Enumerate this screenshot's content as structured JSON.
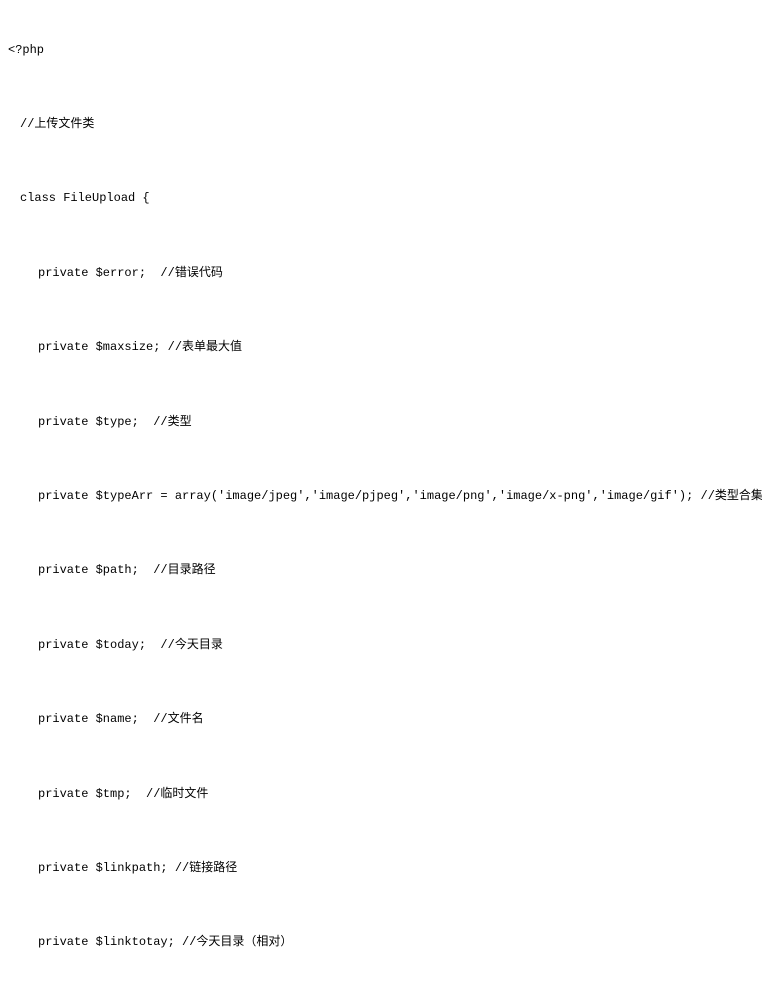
{
  "code": {
    "lines": [
      {
        "indent": 0,
        "text": "<?php"
      },
      {
        "indent": 1,
        "text": "//上传文件类"
      },
      {
        "indent": 1,
        "text": "class FileUpload {"
      },
      {
        "indent": 2,
        "text": "private $error;  //错误代码"
      },
      {
        "indent": 2,
        "text": "private $maxsize; //表单最大值"
      },
      {
        "indent": 2,
        "text": "private $type;  //类型"
      },
      {
        "indent": 2,
        "text": "private $typeArr = array('image/jpeg','image/pjpeg','image/png','image/x-png','image/gif'); //类型合集"
      },
      {
        "indent": 2,
        "text": "private $path;  //目录路径"
      },
      {
        "indent": 2,
        "text": "private $today;  //今天目录"
      },
      {
        "indent": 2,
        "text": "private $name;  //文件名"
      },
      {
        "indent": 2,
        "text": "private $tmp;  //临时文件"
      },
      {
        "indent": 2,
        "text": "private $linkpath; //链接路径"
      },
      {
        "indent": 2,
        "text": "private $linktotay; //今天目录（相对）"
      }
    ]
  }
}
